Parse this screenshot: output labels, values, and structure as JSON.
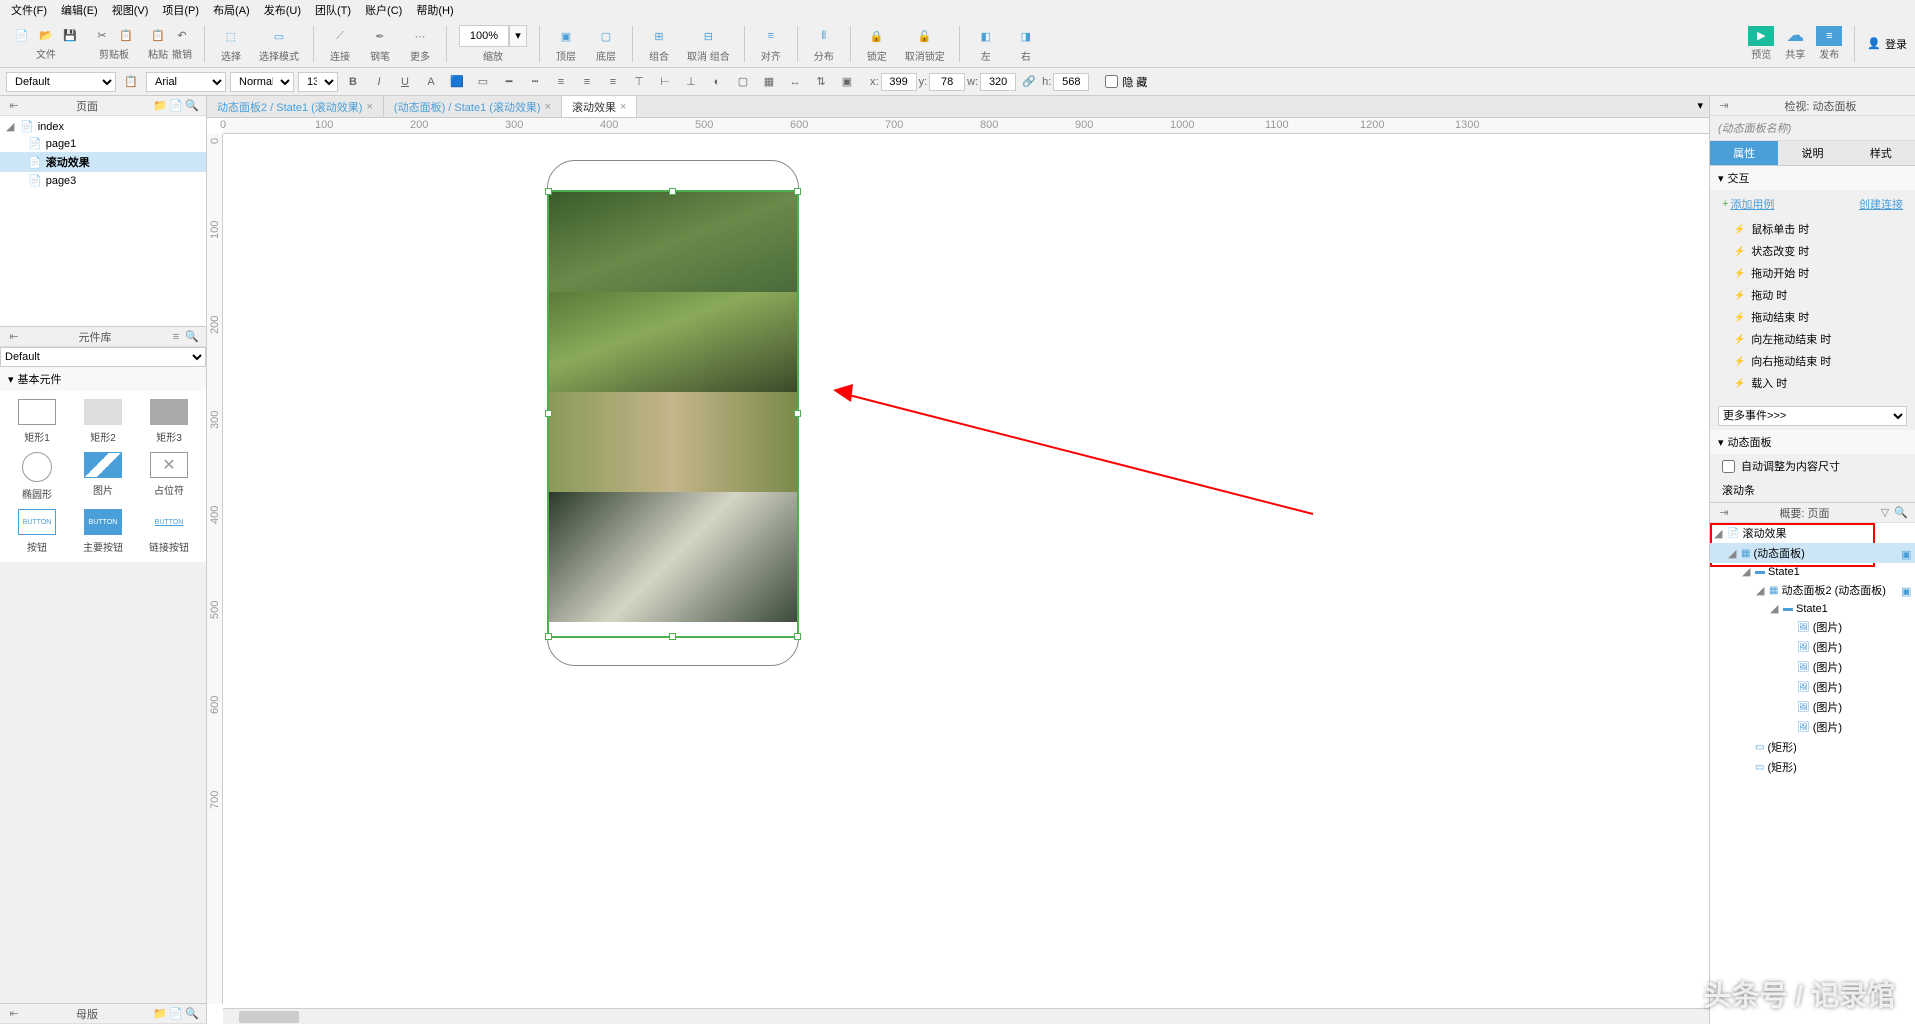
{
  "menubar": [
    "文件(F)",
    "编辑(E)",
    "视图(V)",
    "项目(P)",
    "布局(A)",
    "发布(U)",
    "团队(T)",
    "账户(C)",
    "帮助(H)"
  ],
  "toolbar": {
    "groups": {
      "file": "文件",
      "clipboard": "剪贴板",
      "paste": "粘贴",
      "undo": "撤销",
      "select": "选择",
      "selectMode": "选择模式",
      "connect": "连接",
      "pen": "钢笔",
      "more": "更多",
      "zoom_value": "100%",
      "zoom": "缩放",
      "top": "顶层",
      "bottom": "底层",
      "align_label": "对齐",
      "group": "组合",
      "ungroup": "取消 组合",
      "align": "对齐",
      "distribute": "分布",
      "lock": "锁定",
      "unlock": "取消锁定",
      "left": "左",
      "right": "右"
    },
    "right": {
      "preview": "预览",
      "share": "共享",
      "publish": "发布",
      "login": "登录"
    }
  },
  "formatbar": {
    "style_preset": "Default",
    "font": "Arial",
    "weight": "Normal",
    "size": "13",
    "coords": {
      "x_label": "x:",
      "x": "399",
      "y_label": "y:",
      "y": "78",
      "w_label": "w:",
      "w": "320",
      "h_label": "h:",
      "h": "568"
    },
    "hide_label": "隐 藏"
  },
  "pages": {
    "title": "页面",
    "root": "index",
    "items": [
      "page1",
      "滚动效果",
      "page3"
    ],
    "selected": "滚动效果"
  },
  "library": {
    "title": "元件库",
    "default": "Default",
    "section": "基本元件",
    "items": [
      "矩形1",
      "矩形2",
      "矩形3",
      "椭圆形",
      "图片",
      "占位符",
      "按钮",
      "主要按钮",
      "链接按钮"
    ],
    "btn_text": "BUTTON"
  },
  "masters": {
    "title": "母版"
  },
  "tabs": [
    "动态面板2 / State1 (滚动效果)",
    "(动态面板) / State1 (滚动效果)",
    "滚动效果"
  ],
  "tabs_active": 2,
  "ruler_h": [
    "0",
    "100",
    "200",
    "300",
    "400",
    "500",
    "600",
    "700",
    "800",
    "900",
    "1000",
    "1100",
    "1200",
    "1300"
  ],
  "ruler_v": [
    "0",
    "100",
    "200",
    "300",
    "400",
    "500",
    "600",
    "700"
  ],
  "inspector": {
    "title": "检视: 动态面板",
    "name_placeholder": "(动态面板名称)",
    "tabs": [
      "属性",
      "说明",
      "样式"
    ],
    "interaction": "交互",
    "add_case": "添加用例",
    "create_link": "创建连接",
    "events": [
      "鼠标单击 时",
      "状态改变 时",
      "拖动开始 时",
      "拖动 时",
      "拖动结束 时",
      "向左拖动结束 时",
      "向右拖动结束 时",
      "载入 时"
    ],
    "more_events": "更多事件>>>",
    "dp_section": "动态面板",
    "auto_fit": "自动调整为内容尺寸",
    "scrollbar": "滚动条"
  },
  "outline": {
    "title": "概要: 页面",
    "items": [
      {
        "label": "滚动效果",
        "indent": 0,
        "icon": "page"
      },
      {
        "label": "(动态面板)",
        "indent": 1,
        "icon": "dp",
        "selected": true
      },
      {
        "label": "State1",
        "indent": 2,
        "icon": "state"
      },
      {
        "label": "动态面板2 (动态面板)",
        "indent": 3,
        "icon": "dp"
      },
      {
        "label": "State1",
        "indent": 4,
        "icon": "state"
      },
      {
        "label": "(图片)",
        "indent": 5,
        "icon": "img"
      },
      {
        "label": "(图片)",
        "indent": 5,
        "icon": "img"
      },
      {
        "label": "(图片)",
        "indent": 5,
        "icon": "img"
      },
      {
        "label": "(图片)",
        "indent": 5,
        "icon": "img"
      },
      {
        "label": "(图片)",
        "indent": 5,
        "icon": "img"
      },
      {
        "label": "(图片)",
        "indent": 5,
        "icon": "img"
      },
      {
        "label": "(矩形)",
        "indent": 2,
        "icon": "rect"
      },
      {
        "label": "(矩形)",
        "indent": 2,
        "icon": "rect"
      }
    ]
  },
  "watermark": "头条号 / 记录馆"
}
